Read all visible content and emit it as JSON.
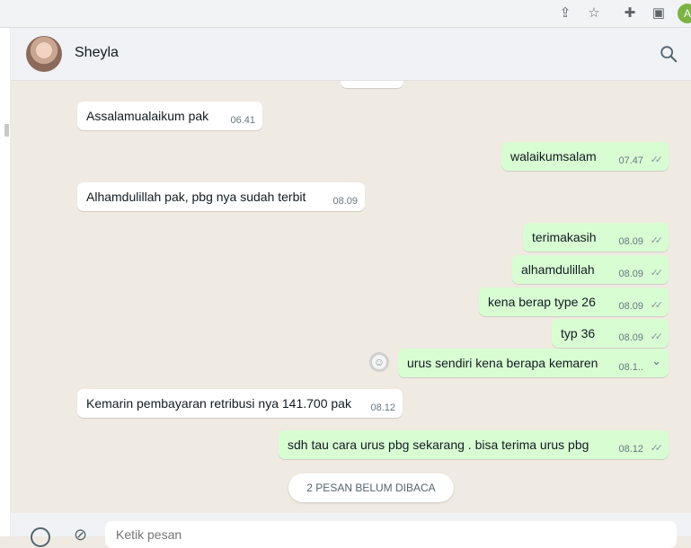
{
  "browser": {
    "icons": [
      "share-icon",
      "star-icon",
      "extensions-icon",
      "side-panel-icon"
    ],
    "profile_initial": "A"
  },
  "header": {
    "contact_name": "Sheyla",
    "search_icon": "search-icon"
  },
  "messages": [
    {
      "dir": "in",
      "text": "Assalamualaikum pak",
      "time": "06.41"
    },
    {
      "dir": "out",
      "text": "walaikumsalam",
      "time": "07.47",
      "status": "read"
    },
    {
      "dir": "in",
      "text": "Alhamdulillah pak, pbg nya sudah terbit",
      "time": "08.09"
    },
    {
      "dir": "out",
      "text": "terimakasih",
      "time": "08.09",
      "status": "read"
    },
    {
      "dir": "out",
      "text": "alhamdulillah",
      "time": "08.09",
      "status": "read"
    },
    {
      "dir": "out",
      "text": "kena berap type 26",
      "time": "08.09",
      "status": "read"
    },
    {
      "dir": "out",
      "text": "typ 36",
      "time": "08.09",
      "status": "read"
    },
    {
      "dir": "out",
      "text": "urus sendiri kena berapa kemaren",
      "time": "08.1..",
      "status": "hover"
    },
    {
      "dir": "in",
      "text": "Kemarin pembayaran retribusi nya 141.700 pak",
      "time": "08.12"
    },
    {
      "dir": "out",
      "text": "sdh  tau cara urus pbg sekarang .  bisa terima urus pbg",
      "time": "08.12",
      "status": "read"
    }
  ],
  "unread_banner": "2 PESAN BELUM DIBACA",
  "composer": {
    "placeholder": "Ketik pesan"
  },
  "colors": {
    "incoming_bubble": "#ffffff",
    "outgoing_bubble": "#d9fdd3",
    "chat_background": "#efeae2",
    "header_background": "#f0f2f5"
  }
}
